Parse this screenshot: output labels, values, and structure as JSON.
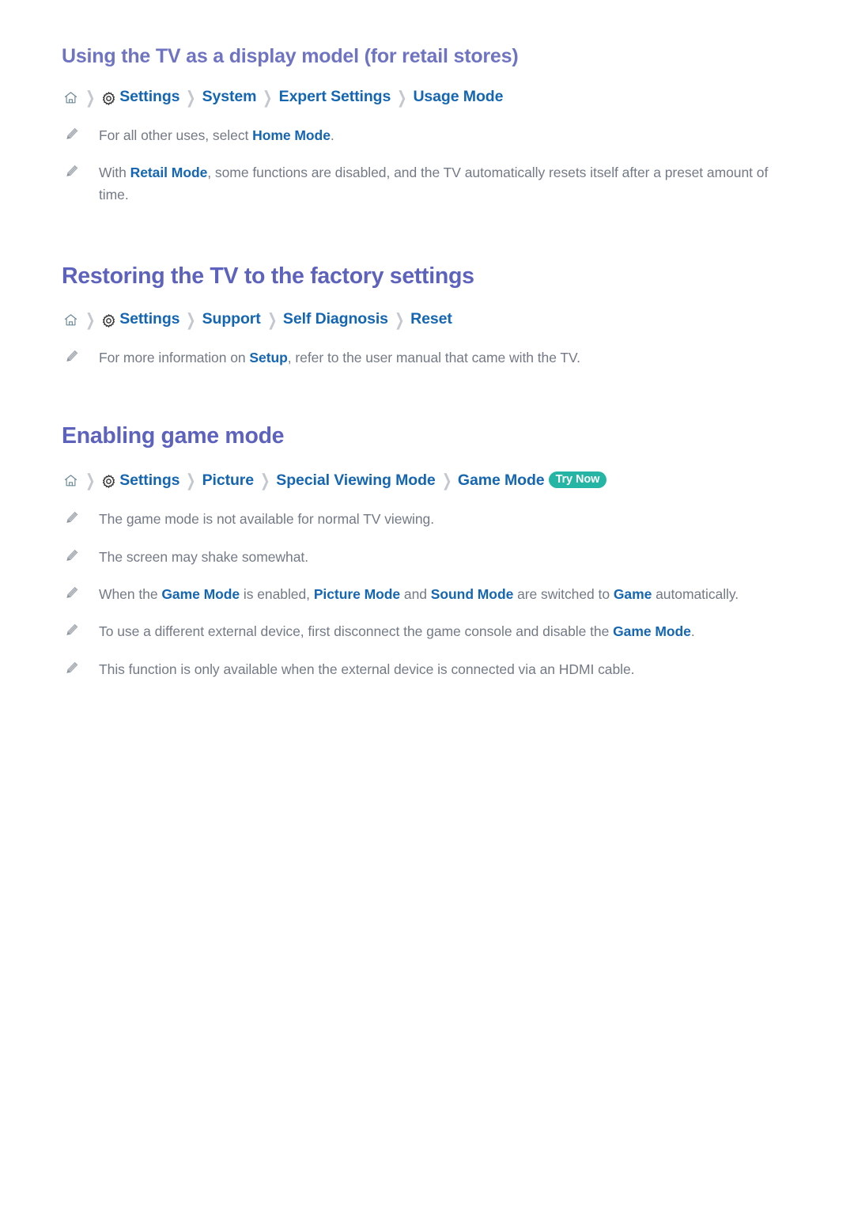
{
  "icons": {
    "home": "home-icon",
    "gear": "gear-icon",
    "separator": "chevron-right-icon",
    "bullet": "pencil-icon"
  },
  "colors": {
    "heading_sub": "#6f74c2",
    "heading_main": "#5d63bd",
    "link_blue": "#1566b2",
    "body_gray": "#737a86",
    "badge_teal": "#25b5a5",
    "separator_gray": "#c3c8cf"
  },
  "sections": [
    {
      "heading": "Using the TV as a display model (for retail stores)",
      "heading_level": "sub",
      "breadcrumb": {
        "home_label": "Home",
        "items": [
          "Settings",
          "System",
          "Expert Settings",
          "Usage Mode"
        ],
        "badge": null
      },
      "bullets": [
        {
          "parts": [
            {
              "t": "For all other uses, select ",
              "b": false
            },
            {
              "t": "Home Mode",
              "b": true
            },
            {
              "t": ".",
              "b": false
            }
          ]
        },
        {
          "parts": [
            {
              "t": "With ",
              "b": false
            },
            {
              "t": "Retail Mode",
              "b": true
            },
            {
              "t": ", some functions are disabled, and the TV automatically resets itself after a preset amount of time.",
              "b": false
            }
          ]
        }
      ]
    },
    {
      "heading": "Restoring the TV to the factory settings",
      "heading_level": "main",
      "breadcrumb": {
        "home_label": "Home",
        "items": [
          "Settings",
          "Support",
          "Self Diagnosis",
          "Reset"
        ],
        "badge": null
      },
      "bullets": [
        {
          "parts": [
            {
              "t": "For more information on ",
              "b": false
            },
            {
              "t": "Setup",
              "b": true
            },
            {
              "t": ", refer to the user manual that came with the TV.",
              "b": false
            }
          ]
        }
      ]
    },
    {
      "heading": "Enabling game mode",
      "heading_level": "main",
      "breadcrumb": {
        "home_label": "Home",
        "items": [
          "Settings",
          "Picture",
          "Special Viewing Mode",
          "Game Mode"
        ],
        "badge": "Try Now"
      },
      "bullets": [
        {
          "parts": [
            {
              "t": "The game mode is not available for normal TV viewing.",
              "b": false
            }
          ]
        },
        {
          "parts": [
            {
              "t": "The screen may shake somewhat.",
              "b": false
            }
          ]
        },
        {
          "parts": [
            {
              "t": "When the ",
              "b": false
            },
            {
              "t": "Game Mode",
              "b": true
            },
            {
              "t": " is enabled, ",
              "b": false
            },
            {
              "t": "Picture Mode",
              "b": true
            },
            {
              "t": " and ",
              "b": false
            },
            {
              "t": "Sound Mode",
              "b": true
            },
            {
              "t": " are switched to ",
              "b": false
            },
            {
              "t": "Game",
              "b": true
            },
            {
              "t": " automatically.",
              "b": false
            }
          ]
        },
        {
          "parts": [
            {
              "t": "To use a different external device, first disconnect the game console and disable the ",
              "b": false
            },
            {
              "t": "Game Mode",
              "b": true
            },
            {
              "t": ".",
              "b": false
            }
          ]
        },
        {
          "parts": [
            {
              "t": "This function is only available when the external device is connected via an HDMI cable.",
              "b": false
            }
          ]
        }
      ]
    }
  ]
}
